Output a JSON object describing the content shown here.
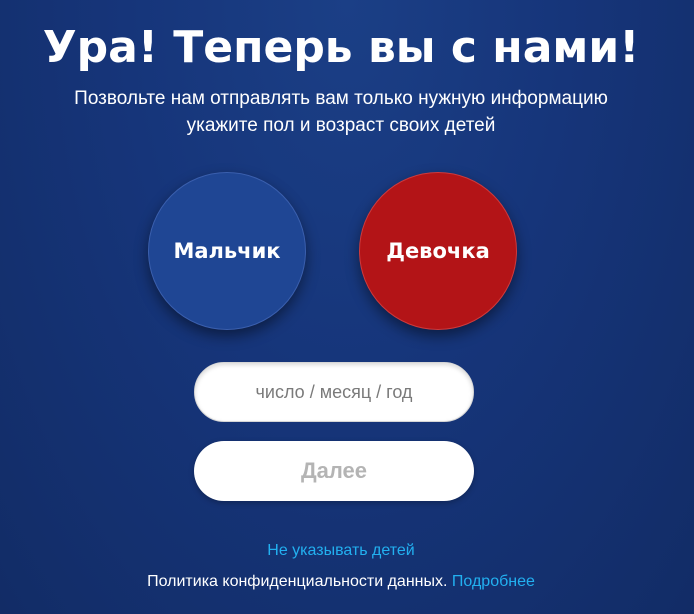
{
  "header": {
    "title": "Ура! Теперь вы с нами!",
    "subtitle_line1": "Позвольте нам отправлять вам только нужную информацию",
    "subtitle_line2": "укажите пол и возраст своих детей"
  },
  "gender": {
    "boy_label": "Мальчик",
    "girl_label": "Девочка",
    "boy_color": "#1f4694",
    "girl_color": "#b31417"
  },
  "form": {
    "date_placeholder": "число / месяц / год",
    "date_value": "",
    "next_label": "Далее"
  },
  "footer": {
    "skip_label": "Не указывать детей",
    "privacy_text": "Политика конфиденциальности данных.",
    "more_label": "Подробнее",
    "link_color": "#22b0f0"
  }
}
